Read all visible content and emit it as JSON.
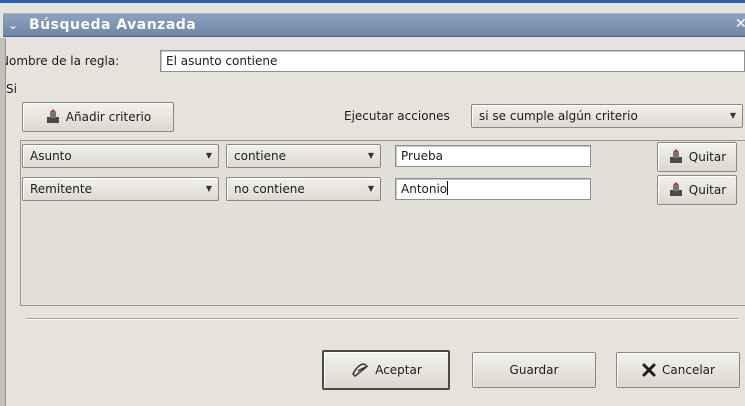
{
  "window": {
    "title": "Búsqueda Avanzada",
    "menu_glyph": "⌄",
    "close_glyph": "✕"
  },
  "rule": {
    "name_label": "Nombre de la regla:",
    "name_value": "El asunto contiene"
  },
  "if_label": "Si",
  "add_criteria_label": "Añadir criterio",
  "execute": {
    "label": "Ejecutar acciones",
    "selected": "si se cumple algún criterio"
  },
  "criteria": [
    {
      "field": "Asunto",
      "operator": "contiene",
      "value": "Prueba",
      "remove_label": "Quitar"
    },
    {
      "field": "Remitente",
      "operator": "no contiene",
      "value": "Antonio",
      "remove_label": "Quitar"
    }
  ],
  "buttons": {
    "accept": "Aceptar",
    "save": "Guardar",
    "cancel": "Cancelar"
  },
  "colors": {
    "title_bar": "#7a90b0",
    "dialog_bg": "#e6e3dd",
    "accent_line": "#2a5fb0"
  },
  "icons": {
    "add": "criteria-icon",
    "remove": "criteria-icon",
    "accept": "ok-icon",
    "cancel": "close-x-icon"
  }
}
